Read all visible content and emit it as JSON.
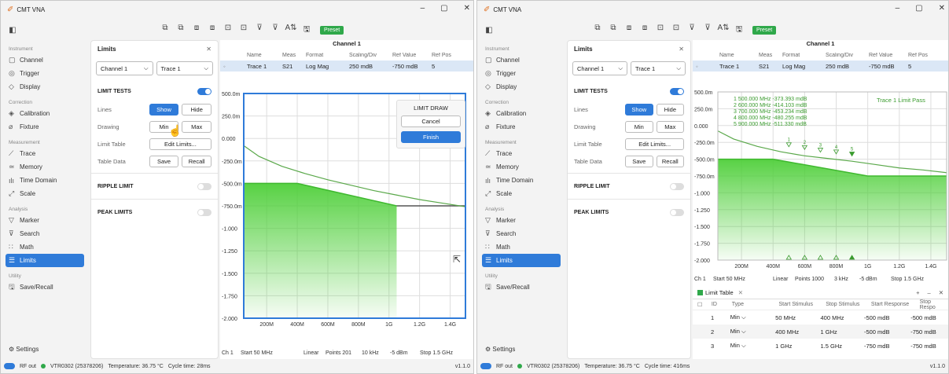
{
  "app_title": "CMT VNA",
  "preset": "Preset",
  "sidebar": {
    "groups": [
      {
        "title": "Instrument",
        "items": [
          {
            "label": "Channel",
            "icon": "channel-icon",
            "glyph": "▢"
          },
          {
            "label": "Trigger",
            "icon": "trigger-icon",
            "glyph": "◎"
          },
          {
            "label": "Display",
            "icon": "display-icon",
            "glyph": "◇"
          }
        ]
      },
      {
        "title": "Correction",
        "items": [
          {
            "label": "Calibration",
            "icon": "calibration-icon",
            "glyph": "◈"
          },
          {
            "label": "Fixture",
            "icon": "fixture-icon",
            "glyph": "⌀"
          }
        ]
      },
      {
        "title": "Measurement",
        "items": [
          {
            "label": "Trace",
            "icon": "trace-icon",
            "glyph": "⟋"
          },
          {
            "label": "Memory",
            "icon": "memory-icon",
            "glyph": "≃"
          },
          {
            "label": "Time Domain",
            "icon": "time-domain-icon",
            "glyph": "ılı"
          },
          {
            "label": "Scale",
            "icon": "scale-icon",
            "glyph": "⤢"
          }
        ]
      },
      {
        "title": "Analysis",
        "items": [
          {
            "label": "Marker",
            "icon": "marker-icon",
            "glyph": "▽"
          },
          {
            "label": "Search",
            "icon": "search-icon",
            "glyph": "⊽"
          },
          {
            "label": "Math",
            "icon": "math-icon",
            "glyph": "∷"
          },
          {
            "label": "Limits",
            "icon": "limits-icon",
            "glyph": "☰"
          }
        ]
      },
      {
        "title": "Utility",
        "items": [
          {
            "label": "Save/Recall",
            "icon": "save-recall-icon",
            "glyph": "🖫"
          }
        ]
      }
    ],
    "settings": "Settings"
  },
  "limits_panel": {
    "title": "Limits",
    "channel": "Channel 1",
    "trace": "Trace 1",
    "limit_tests": "LIMIT TESTS",
    "lines": "Lines",
    "show": "Show",
    "hide": "Hide",
    "drawing": "Drawing",
    "min": "Min",
    "max": "Max",
    "limit_table": "Limit Table",
    "edit_limits": "Edit Limits...",
    "table_data": "Table Data",
    "save": "Save",
    "recall": "Recall",
    "ripple_limit": "RIPPLE LIMIT",
    "peak_limits": "PEAK LIMITS"
  },
  "channel_header": "Channel 1",
  "trace_table": {
    "columns": [
      "Name",
      "Meas",
      "Format",
      "Scaling/Div",
      "Ref Value",
      "Ref Pos"
    ],
    "row": [
      "Trace 1",
      "S21",
      "Log Mag",
      "250 mdB",
      "-750 mdB",
      "5"
    ]
  },
  "limit_draw": {
    "title": "LIMIT DRAW",
    "cancel": "Cancel",
    "finish": "Finish"
  },
  "chart_data": [
    {
      "type": "line",
      "y_tick_labels": [
        "500.0m",
        "250.0m",
        "0.000",
        "-250.0m",
        "-500.0m",
        "-750.0m",
        "-1.000",
        "-1.250",
        "-1.500",
        "-1.750",
        "-2.000"
      ],
      "x_tick_labels": [
        "200M",
        "400M",
        "600M",
        "800M",
        "1G",
        "1.2G",
        "1.4G"
      ],
      "ylim": [
        -2.0,
        0.5
      ],
      "xlim": [
        50,
        1500
      ],
      "series": [
        {
          "x": [
            50,
            150,
            300,
            450,
            600,
            750,
            900,
            1050,
            1200,
            1350,
            1500
          ],
          "y": [
            -0.08,
            -0.2,
            -0.31,
            -0.39,
            -0.46,
            -0.52,
            -0.58,
            -0.63,
            -0.68,
            -0.72,
            -0.76
          ]
        }
      ],
      "limit_segments": [
        {
          "x": [
            50,
            400
          ],
          "y": [
            -0.5,
            -0.5
          ]
        },
        {
          "x": [
            400,
            1050
          ],
          "y": [
            -0.5,
            -0.75
          ]
        },
        {
          "x": [
            1050,
            1500
          ],
          "y": [
            -0.75,
            -0.75
          ]
        }
      ],
      "grid": true
    },
    {
      "type": "line",
      "y_tick_labels": [
        "500.0m",
        "250.0m",
        "0.000",
        "-250.0m",
        "-500.0m",
        "-750.0m",
        "-1.000",
        "-1.250",
        "-1.500",
        "-1.750",
        "-2.000"
      ],
      "x_tick_labels": [
        "200M",
        "400M",
        "600M",
        "800M",
        "1G",
        "1.2G",
        "1.4G"
      ],
      "ylim": [
        -2.0,
        0.5
      ],
      "xlim": [
        50,
        1500
      ],
      "series": [
        {
          "x": [
            50,
            150,
            300,
            450,
            600,
            750,
            900,
            1050,
            1200,
            1350,
            1500
          ],
          "y": [
            -0.08,
            -0.2,
            -0.31,
            -0.39,
            -0.45,
            -0.49,
            -0.53,
            -0.58,
            -0.63,
            -0.66,
            -0.7
          ]
        }
      ],
      "limit_segments": [
        {
          "x": [
            50,
            400
          ],
          "y": [
            -0.5,
            -0.5
          ]
        },
        {
          "x": [
            400,
            1000
          ],
          "y": [
            -0.5,
            -0.75
          ]
        },
        {
          "x": [
            1000,
            1500
          ],
          "y": [
            -0.75,
            -0.75
          ]
        }
      ],
      "grid": true,
      "markers": [
        {
          "n": "1",
          "x": 500,
          "y": -0.373
        },
        {
          "n": "2",
          "x": 600,
          "y": -0.414
        },
        {
          "n": "3",
          "x": 700,
          "y": -0.453
        },
        {
          "n": "4",
          "x": 800,
          "y": -0.48
        },
        {
          "n": "5",
          "x": 900,
          "y": -0.511
        }
      ]
    }
  ],
  "left_footer": {
    "ch": "Ch 1",
    "start": "Start 50 MHz",
    "linear": "Linear",
    "points": "Points 201",
    "ifbw": "10 kHz",
    "power": "-5 dBm",
    "stop": "Stop 1.5 GHz"
  },
  "right_footer": {
    "ch": "Ch 1",
    "start": "Start 50 MHz",
    "linear": "Linear",
    "points": "Points 1000",
    "ifbw": "3 kHz",
    "power": "-5 dBm",
    "stop": "Stop 1.5 GHz"
  },
  "markers_text": [
    "1  500.000 MHz  -373.393 mdB",
    "2  600.000 MHz  -414.103 mdB",
    "3  700.000 MHz  -453.234 mdB",
    "4  800.000 MHz  -480.255 mdB",
    "5  900.000 MHz  -511.330 mdB"
  ],
  "pass_text": "Trace 1 Limit Pass",
  "limit_table": {
    "tab": "Limit Table",
    "columns": [
      "ID",
      "Type",
      "Start Stimulus",
      "Stop Stimulus",
      "Start Response",
      "Stop Respo"
    ],
    "rows": [
      [
        "1",
        "Min",
        "50 MHz",
        "400 MHz",
        "-500 mdB",
        "-500 mdB"
      ],
      [
        "2",
        "Min",
        "400 MHz",
        "1 GHz",
        "-500 mdB",
        "-750 mdB"
      ],
      [
        "3",
        "Min",
        "1 GHz",
        "1.5 GHz",
        "-750 mdB",
        "-750 mdB"
      ]
    ]
  },
  "status_left": {
    "rf": "RF out",
    "device": "VTR0302 (25378206)",
    "temp": "Temperature: 36.75 °C",
    "cycle": "Cycle time: 28ms",
    "ver": "v1.1.0"
  },
  "status_right": {
    "rf": "RF out",
    "device": "VTR0302 (25378206)",
    "temp": "Temperature: 36.75 °C",
    "cycle": "Cycle time: 416ms",
    "ver": "v1.1.0"
  },
  "colors": {
    "accent": "#2f7bd9",
    "green": "#2fa84a",
    "trace": "#5aa84a",
    "fill": "#4fcf3a"
  }
}
